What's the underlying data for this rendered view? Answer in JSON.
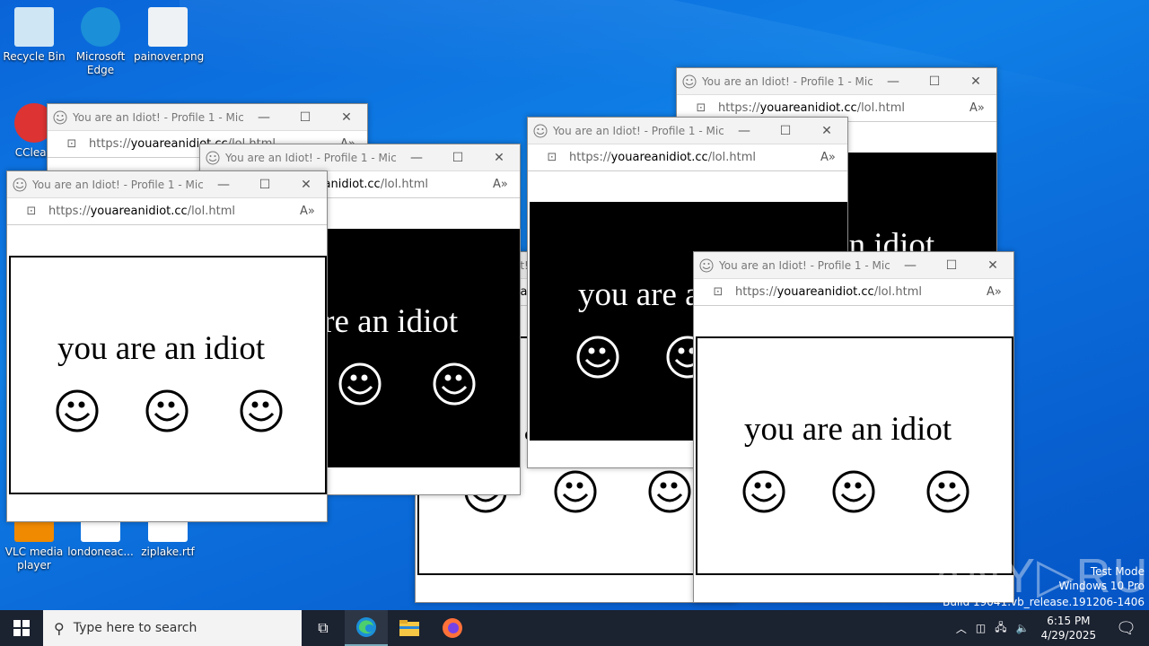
{
  "desktop_icons": [
    {
      "label": "Recycle Bin",
      "icon": "recycle-bin-icon"
    },
    {
      "label": "Microsoft Edge",
      "icon": "edge-icon"
    },
    {
      "label": "painover.png",
      "icon": "image-file-icon"
    },
    {
      "label": "CClean",
      "icon": "ccleaner-icon"
    },
    {
      "label": "VLC media player",
      "icon": "vlc-icon"
    },
    {
      "label": "londoneac...",
      "icon": "file-icon"
    },
    {
      "label": "ziplake.rtf",
      "icon": "rtf-file-icon"
    }
  ],
  "browser_windows": [
    {
      "title": "You are an Idiot! - Profile 1 - Micro...",
      "url_prefix": "https://",
      "url_domain": "youareanidiot.cc",
      "url_path": "/lol.html",
      "text": "you are an idiot",
      "inverted": false
    },
    {
      "title": "You are an Idiot! - Profile 1 - Micro...",
      "url_prefix": "https://",
      "url_domain": "youareanidiot.cc",
      "url_path": "/lol.html",
      "text": "you are an idiot",
      "inverted": true
    },
    {
      "title": "You are an Idiot! - Profile 1 - Micro...",
      "url_prefix": "https://",
      "url_domain": "youareanidiot.cc",
      "url_path": "/lol.html",
      "text": "you are an idiot",
      "inverted": false
    },
    {
      "title": "You are an Idiot! - Profile 1 - Micro...",
      "url_prefix": "https://",
      "url_domain": "youareanidiot.cc",
      "url_path": "/lol.html",
      "text": "you are an idiot",
      "inverted": true
    },
    {
      "title": "You are an Idiot! - Profile 1 - Micro...",
      "url_prefix": "https://",
      "url_domain": "youareanidiot.cc",
      "url_path": "/lol.html",
      "text": "you are an idiot",
      "inverted": false
    },
    {
      "title": "You are an Idiot! - Profile 1 - Micro...",
      "url_prefix": "https://",
      "url_domain": "youareanidiot.cc",
      "url_path": "/lol.html",
      "text": "you are an idiot",
      "inverted": true
    },
    {
      "title": "You are an Idiot! - Profile 1 - Micro...",
      "url_prefix": "https://",
      "url_domain": "youareanidiot.cc",
      "url_path": "/lol.html",
      "text": "you are an idiot",
      "inverted": false
    }
  ],
  "window_controls": {
    "minimize": "—",
    "maximize": "☐",
    "close": "✕",
    "read_aloud": "A⁾",
    "lock": "🔒"
  },
  "taskbar": {
    "search_placeholder": "Type here to search",
    "time": "6:15 PM",
    "date": "4/29/2025",
    "pinned": [
      "task-view",
      "edge",
      "file-explorer",
      "firefox"
    ]
  },
  "watermark": {
    "line1": "Test Mode",
    "line2": "Windows 10 Pro",
    "line3": "Build 19041.vb_release.191206-1406",
    "logo": "ANY.RUN"
  }
}
